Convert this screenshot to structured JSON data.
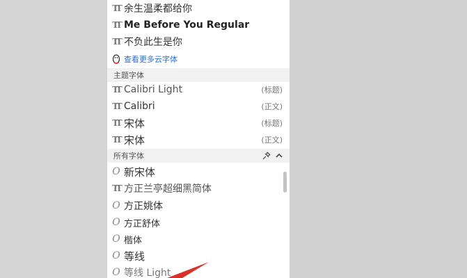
{
  "recent_fonts": [
    {
      "name": "余生温柔都给你",
      "icon": "tt-icon"
    },
    {
      "name": "Me Before You Regular",
      "icon": "tt-icon"
    },
    {
      "name": "不负此生是你",
      "icon": "tt-icon"
    }
  ],
  "more_cloud_fonts": {
    "label": "查看更多云字体",
    "icon": "penguin-icon"
  },
  "theme_section": {
    "label": "主题字体"
  },
  "theme_fonts": [
    {
      "name": "Calibri Light",
      "tag": "(标题)",
      "icon": "tt-icon"
    },
    {
      "name": "Calibri",
      "tag": "(正文)",
      "icon": "tt-icon"
    },
    {
      "name": "宋体",
      "tag": "(标题)",
      "icon": "tt-icon"
    },
    {
      "name": "宋体",
      "tag": "(正文)",
      "icon": "tt-icon"
    }
  ],
  "all_section": {
    "label": "所有字体",
    "icons": [
      "pin-icon",
      "collapse-chevron-icon"
    ]
  },
  "all_fonts": [
    {
      "name": "新宋体",
      "icon": "opentype-icon"
    },
    {
      "name": "方正兰亭超细黑简体",
      "icon": "tt-icon"
    },
    {
      "name": "方正姚体",
      "icon": "opentype-icon"
    },
    {
      "name": "方正舒体",
      "icon": "opentype-icon"
    },
    {
      "name": "楷体",
      "icon": "opentype-icon"
    },
    {
      "name": "等线",
      "icon": "opentype-icon"
    },
    {
      "name": "等线 Light",
      "icon": "opentype-icon"
    }
  ],
  "colors": {
    "accent_link": "#2f6fd6",
    "arrow": "#d9322b",
    "section_bg": "#f1f1f1",
    "backdrop": "#d4d4d4"
  }
}
